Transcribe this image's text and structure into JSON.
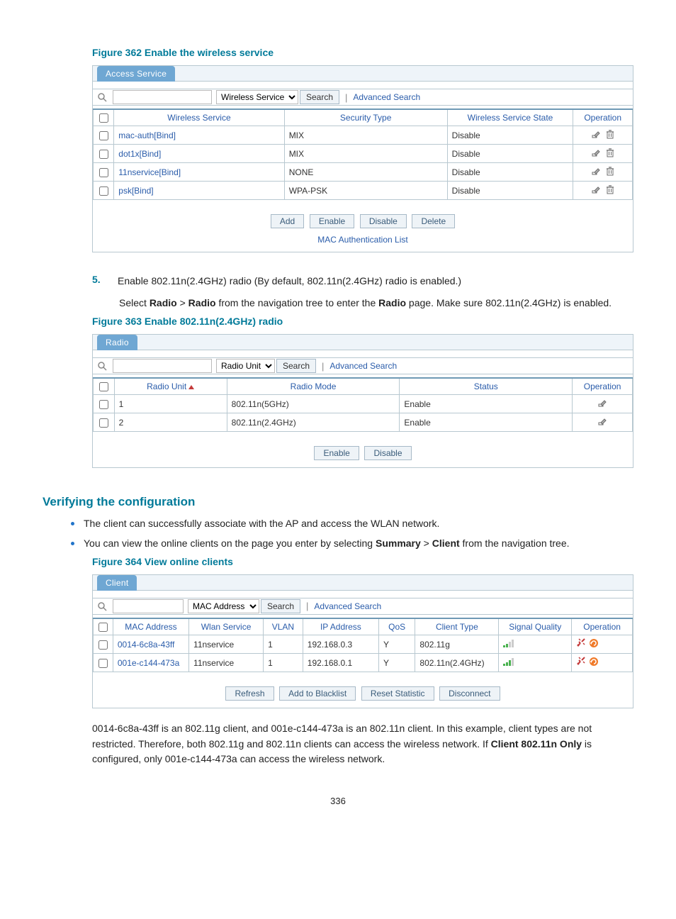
{
  "page_number": "336",
  "figure362": {
    "caption": "Figure 362 Enable the wireless service",
    "tab": "Access Service",
    "search_filter": "Wireless Service",
    "search_btn": "Search",
    "adv_search": "Advanced Search",
    "headers": {
      "ws": "Wireless Service",
      "sec": "Security Type",
      "state": "Wireless Service State",
      "op": "Operation"
    },
    "rows": [
      {
        "name": "mac-auth",
        "link": "[Bind]",
        "sec": "MIX",
        "state": "Disable"
      },
      {
        "name": "dot1x",
        "link": "[Bind]",
        "sec": "MIX",
        "state": "Disable"
      },
      {
        "name": "11nservice",
        "link": "[Bind]",
        "sec": "NONE",
        "state": "Disable"
      },
      {
        "name": "psk",
        "link": "[Bind]",
        "sec": "WPA-PSK",
        "state": "Disable"
      }
    ],
    "buttons": {
      "add": "Add",
      "enable": "Enable",
      "disable": "Disable",
      "delete": "Delete"
    },
    "mac_link": "MAC Authentication List"
  },
  "step5": {
    "n": "5.",
    "title": "Enable 802.11n(2.4GHz) radio (By default, 802.11n(2.4GHz) radio is enabled.)",
    "para_a": "Select ",
    "para_bold1": "Radio",
    "para_gt": " > ",
    "para_bold2": "Radio",
    "para_b": " from the navigation tree to enter the ",
    "para_bold3": "Radio",
    "para_c": " page. Make sure 802.11n(2.4GHz) is enabled."
  },
  "figure363": {
    "caption": "Figure 363 Enable 802.11n(2.4GHz) radio",
    "tab": "Radio",
    "search_filter": "Radio Unit",
    "search_btn": "Search",
    "adv_search": "Advanced Search",
    "headers": {
      "unit": "Radio Unit",
      "mode": "Radio Mode",
      "status": "Status",
      "op": "Operation"
    },
    "rows": [
      {
        "unit": "1",
        "mode": "802.11n(5GHz)",
        "status": "Enable"
      },
      {
        "unit": "2",
        "mode": "802.11n(2.4GHz)",
        "status": "Enable"
      }
    ],
    "buttons": {
      "enable": "Enable",
      "disable": "Disable"
    }
  },
  "verify": {
    "heading": "Verifying the configuration",
    "b1": "The client can successfully associate with the AP and access the WLAN network.",
    "b2a": "You can view the online clients on the page you enter by selecting ",
    "b2b": "Summary",
    "b2gt": " > ",
    "b2c": "Client",
    "b2d": " from the navigation tree."
  },
  "figure364": {
    "caption": "Figure 364 View online clients",
    "tab": "Client",
    "search_filter": "MAC Address",
    "search_btn": "Search",
    "adv_search": "Advanced Search",
    "headers": {
      "mac": "MAC Address",
      "wsvc": "Wlan Service",
      "vlan": "VLAN",
      "ip": "IP Address",
      "qos": "QoS",
      "ctype": "Client Type",
      "sq": "Signal Quality",
      "op": "Operation"
    },
    "rows": [
      {
        "mac": "0014-6c8a-43ff",
        "svc": "11nservice",
        "vlan": "1",
        "ip": "192.168.0.3",
        "qos": "Y",
        "ctype": "802.11g",
        "sig": 2
      },
      {
        "mac": "001e-c144-473a",
        "svc": "11nservice",
        "vlan": "1",
        "ip": "192.168.0.1",
        "qos": "Y",
        "ctype": "802.11n(2.4GHz)",
        "sig": 3
      }
    ],
    "buttons": {
      "refresh": "Refresh",
      "black": "Add to Blacklist",
      "reset": "Reset Statistic",
      "disc": "Disconnect"
    }
  },
  "closing": {
    "t1": "0014-6c8a-43ff is an 802.11g client, and 001e-c144-473a is an 802.11n client. In this example, client types are not restricted. Therefore, both 802.11g and 802.11n clients can access the wireless network. If ",
    "bold": "Client 802.11n Only",
    "t2": " is configured, only 001e-c144-473a can access the wireless network."
  }
}
